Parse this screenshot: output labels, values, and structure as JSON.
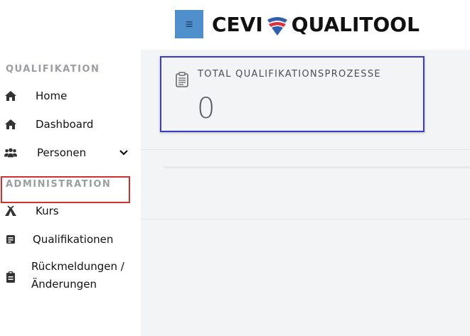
{
  "header": {
    "brand_left": "CEVI",
    "brand_right": "QUALITOOL",
    "menu_icon": "hamburger-icon",
    "colors": {
      "menu_button": "#4e8fcc",
      "logo_blue": "#2f5fb0",
      "logo_red": "#d8343a"
    }
  },
  "sidebar": {
    "sections": [
      {
        "title": "QUALIFIKATION",
        "items": [
          {
            "label": "Home",
            "icon": "home-icon"
          },
          {
            "label": "Dashboard",
            "icon": "home-icon"
          },
          {
            "label": "Personen",
            "icon": "users-icon",
            "expandable": true
          }
        ]
      },
      {
        "title": "ADMINISTRATION",
        "items": [
          {
            "label": "Kurs",
            "icon": "campfire-icon"
          },
          {
            "label": "Qualifikationen",
            "icon": "document-icon",
            "highlighted": true
          },
          {
            "label_line1": "Rückmeldungen /",
            "label_line2": "Änderungen",
            "icon": "clipboard-icon"
          }
        ]
      }
    ],
    "colors": {
      "section_title": "#9a9ea3",
      "highlight_border": "#d32f2f"
    }
  },
  "main": {
    "stat_card": {
      "label": "TOTAL QUALIFIKATIONSPROZESSE",
      "value": "0",
      "icon": "clipboard-list-icon",
      "border_color": "#3b3bd1"
    }
  }
}
